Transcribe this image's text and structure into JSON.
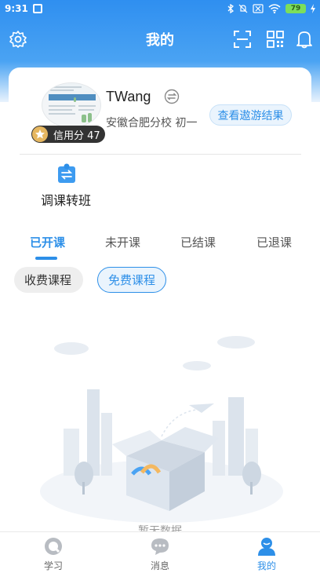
{
  "status_bar": {
    "time": "9:31",
    "battery": "79"
  },
  "header": {
    "title": "我的"
  },
  "profile": {
    "username": "TWang",
    "school_grade": "安徽合肥分校 初一",
    "credit_label": "信用分 47",
    "invite_button": "查看遨游结果"
  },
  "quick_actions": [
    {
      "label": "调课转班",
      "icon": "transfer-class-icon"
    }
  ],
  "tabs": [
    {
      "label": "已开课",
      "active": true
    },
    {
      "label": "未开课",
      "active": false
    },
    {
      "label": "已结课",
      "active": false
    },
    {
      "label": "已退课",
      "active": false
    }
  ],
  "filters": [
    {
      "label": "收费课程",
      "selected": false
    },
    {
      "label": "免费课程",
      "selected": true
    }
  ],
  "empty_state": {
    "text": "暂无数据"
  },
  "bottom_nav": [
    {
      "label": "学习",
      "icon": "study-icon",
      "active": false
    },
    {
      "label": "消息",
      "icon": "message-icon",
      "active": false
    },
    {
      "label": "我的",
      "icon": "profile-icon",
      "active": true
    }
  ],
  "colors": {
    "accent": "#2d8fe8",
    "header_gradient_top": "#2f8ff0",
    "credit_badge": "#333333",
    "star": "#e6b760"
  }
}
